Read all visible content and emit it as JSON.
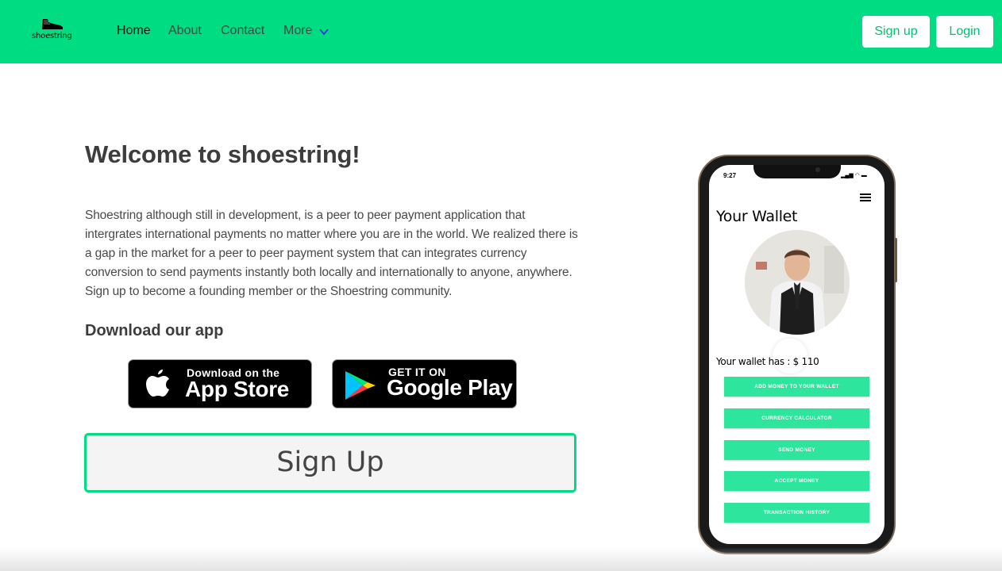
{
  "brand": {
    "logo_text": "shoestring",
    "accent_color": "#00dc82"
  },
  "nav": {
    "links": [
      "Home",
      "About",
      "Contact",
      "More"
    ],
    "active": "Home",
    "signup_label": "Sign up",
    "login_label": "Login"
  },
  "hero": {
    "title": "Welcome to shoestring!",
    "description": "Shoestring although still in development, is a peer to peer payment application that intergrates international payments no matter where you are in the world. We realized there is a gap in the market for a peer to peer payment system that can integrates currency conversion to send payments instantly both locally and internationally to anyone, anywhere. Sign up to become a founding member or the Shoestring community.",
    "download_heading": "Download our app",
    "app_store": {
      "small": "Download on the",
      "big": "App Store"
    },
    "google_play": {
      "small": "GET IT ON",
      "big": "Google Play"
    },
    "signup_button": "Sign Up"
  },
  "phone": {
    "time": "9:27",
    "wallet_title": "Your Wallet",
    "balance_text": "Your wallet has : $ 110",
    "actions": [
      "ADD MONEY TO YOUR WALLET",
      "CURRENCY CALCULATOR",
      "SEND MONEY",
      "ACCEPT MONEY",
      "TRANSACTION HISTORY"
    ]
  }
}
